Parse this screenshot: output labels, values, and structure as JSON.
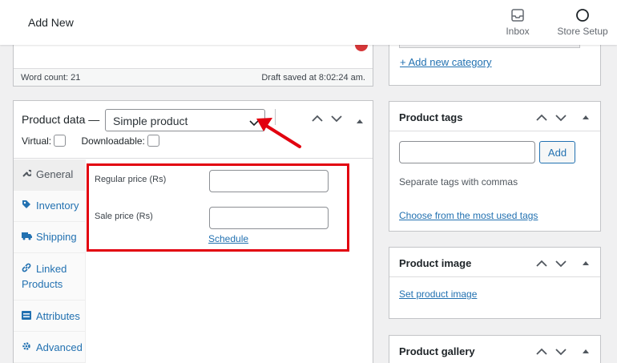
{
  "topbar": {
    "title": "Add New",
    "inbox_label": "Inbox",
    "store_setup_label": "Store Setup"
  },
  "editor": {
    "word_count": "Word count: 21",
    "draft_saved": "Draft saved at 8:02:24 am."
  },
  "product_data": {
    "label": "Product data —",
    "type_select": "Simple product",
    "virtual_label": "Virtual:",
    "downloadable_label": "Downloadable:",
    "tabs": [
      {
        "label": "General",
        "icon": "wrench-icon"
      },
      {
        "label": "Inventory",
        "icon": "tag-icon"
      },
      {
        "label": "Shipping",
        "icon": "truck-icon"
      },
      {
        "label": "Linked Products",
        "icon": "link-icon"
      },
      {
        "label": "Attributes",
        "icon": "list-icon"
      },
      {
        "label": "Advanced",
        "icon": "gear-icon"
      }
    ],
    "regular_price_label": "Regular price (Rs)",
    "sale_price_label": "Sale price (Rs)",
    "schedule_link": "Schedule"
  },
  "sidebar": {
    "category_link": "+ Add new category",
    "tags": {
      "title": "Product tags",
      "add_button": "Add",
      "help": "Separate tags with commas",
      "choose_link": "Choose from the most used tags"
    },
    "image": {
      "title": "Product image",
      "set_link": "Set product image"
    },
    "gallery": {
      "title": "Product gallery"
    }
  },
  "colors": {
    "link": "#2271b1",
    "annotation_red": "#e2000f",
    "border": "#c3c4c7"
  }
}
